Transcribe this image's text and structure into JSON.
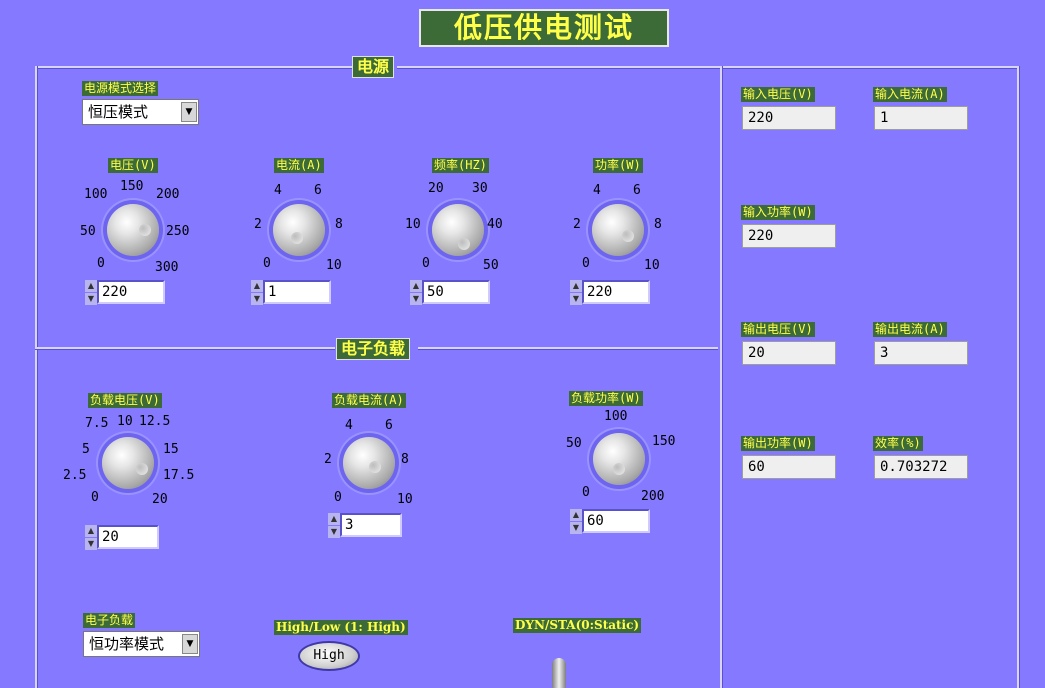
{
  "title": "低压供电测试",
  "power_section": {
    "label": "电源",
    "mode_label": "电源模式选择",
    "mode_value": "恒压模式",
    "knobs": [
      {
        "label": "电压(V)",
        "ticks": [
          "0",
          "50",
          "100",
          "150",
          "200",
          "250",
          "300"
        ],
        "value": "220"
      },
      {
        "label": "电流(A)",
        "ticks": [
          "0",
          "2",
          "4",
          "6",
          "8",
          "10"
        ],
        "value": "1"
      },
      {
        "label": "频率(HZ)",
        "ticks": [
          "0",
          "10",
          "20",
          "30",
          "40",
          "50"
        ],
        "value": "50"
      },
      {
        "label": "功率(W)",
        "ticks": [
          "0",
          "2",
          "4",
          "6",
          "8",
          "10"
        ],
        "value": "220"
      }
    ]
  },
  "load_section": {
    "label": "电子负载",
    "knobs": [
      {
        "label": "负载电压(V)",
        "ticks": [
          "0",
          "2.5",
          "5",
          "7.5",
          "10",
          "12.5",
          "15",
          "17.5",
          "20"
        ],
        "value": "20"
      },
      {
        "label": "负载电流(A)",
        "ticks": [
          "0",
          "2",
          "4",
          "6",
          "8",
          "10"
        ],
        "value": "3"
      },
      {
        "label": "负载功率(W)",
        "ticks": [
          "0",
          "50",
          "100",
          "150",
          "200"
        ],
        "value": "60"
      }
    ],
    "mode_label": "电子负载",
    "mode_value": "恒功率模式",
    "highlow_label": "High/Low (1: High)",
    "highlow_value": "High",
    "dynsta_label": "DYN/STA(0:Static)"
  },
  "indicators": {
    "in_voltage": {
      "label": "输入电压(V)",
      "value": "220"
    },
    "in_current": {
      "label": "输入电流(A)",
      "value": "1"
    },
    "in_power": {
      "label": "输入功率(W)",
      "value": "220"
    },
    "out_voltage": {
      "label": "输出电压(V)",
      "value": "20"
    },
    "out_current": {
      "label": "输出电流(A)",
      "value": "3"
    },
    "out_power": {
      "label": "输出功率(W)",
      "value": "60"
    },
    "efficiency": {
      "label": "效率(%)",
      "value": "0.703272"
    }
  },
  "colors": {
    "background": "#8479ff",
    "label_bg": "#3d6b37",
    "label_fg": "#ffff4a"
  }
}
